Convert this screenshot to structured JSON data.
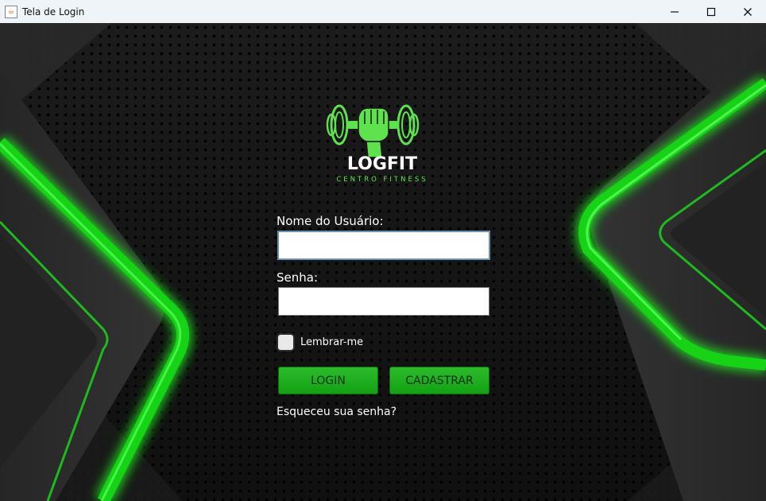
{
  "window": {
    "title": "Tela de Login",
    "app_icon": "java-cup-icon",
    "controls": {
      "minimize": "—",
      "maximize": "☐",
      "close": "✕"
    }
  },
  "logo": {
    "name": "LOGFIT",
    "tagline": "CENTRO FITNESS",
    "icon": "fist-dumbbell-icon",
    "color": "#5ee34e"
  },
  "form": {
    "username_label": "Nome do Usuário:",
    "username_value": "",
    "password_label": "Senha:",
    "password_value": "",
    "remember_label": "Lembrar-me",
    "remember_checked": false,
    "login_button": "LOGIN",
    "register_button": "CADASTRAR",
    "forgot_link": "Esqueceu sua senha?"
  },
  "colors": {
    "accent_green": "#1fb01f",
    "neon_green": "#22e622",
    "background": "#141414",
    "titlebar": "#eff4f9"
  }
}
